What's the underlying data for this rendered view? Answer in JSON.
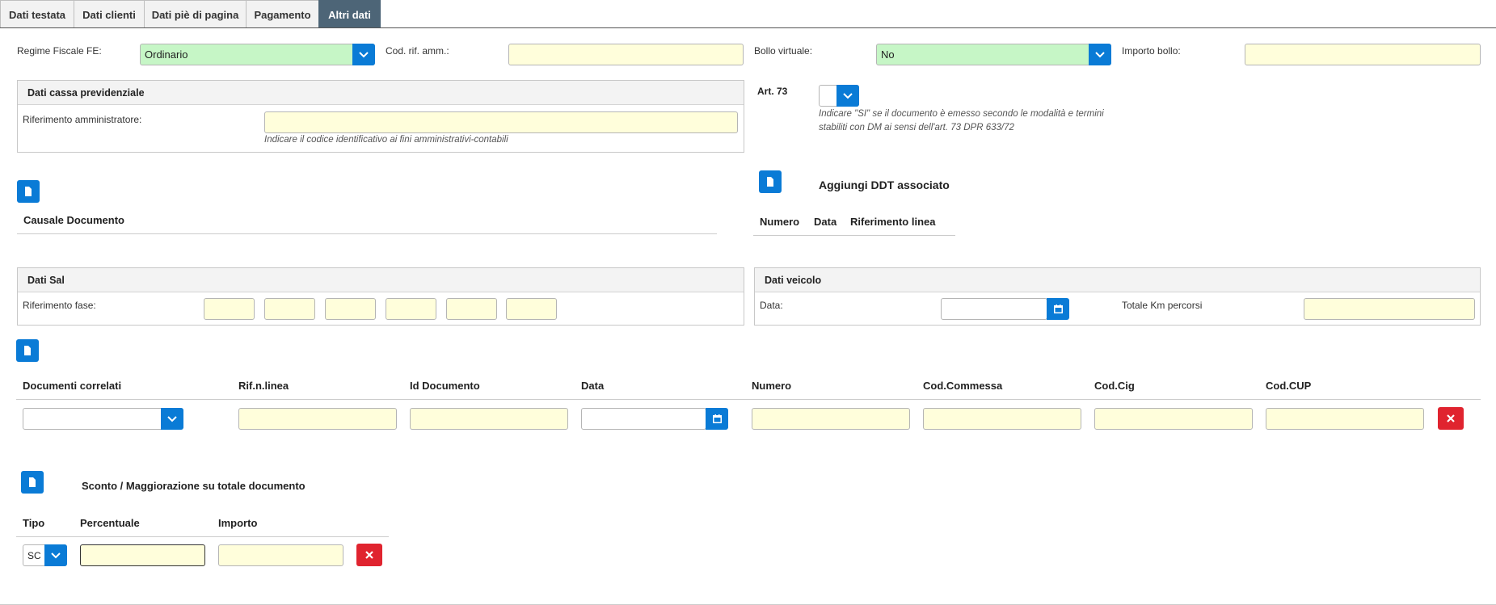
{
  "tabs": [
    "Dati testata",
    "Dati clienti",
    "Dati piè di pagina",
    "Pagamento",
    "Altri dati"
  ],
  "top": {
    "regime_label": "Regime Fiscale FE:",
    "regime_value": "Ordinario",
    "cod_rif_label": "Cod. rif. amm.:",
    "bollo_label": "Bollo virtuale:",
    "bollo_value": "No",
    "importo_bollo_label": "Importo bollo:"
  },
  "cassa": {
    "title": "Dati cassa previdenziale",
    "rif_label": "Riferimento amministratore:",
    "hint": "Indicare il codice identificativo ai fini amministrativi-contabili"
  },
  "art73": {
    "label": "Art. 73",
    "hint_line1": "Indicare \"SI\" se il documento è emesso secondo le modalità e termini",
    "hint_line2": "stabiliti con DM ai sensi dell'art. 73 DPR 633/72"
  },
  "causale": {
    "title": "Causale Documento"
  },
  "ddt": {
    "title": "Aggiungi DDT associato",
    "columns": [
      "Numero",
      "Data",
      "Riferimento linea"
    ]
  },
  "sal": {
    "title": "Dati Sal",
    "rif_label": "Riferimento fase:"
  },
  "veicolo": {
    "title": "Dati veicolo",
    "data_label": "Data:",
    "km_label": "Totale Km percorsi"
  },
  "correlati": {
    "columns": [
      "Documenti correlati",
      "Rif.n.linea",
      "Id Documento",
      "Data",
      "Numero",
      "Cod.Commessa",
      "Cod.Cig",
      "Cod.CUP"
    ]
  },
  "sconto": {
    "title": "Sconto / Maggiorazione su totale documento",
    "columns": [
      "Tipo",
      "Percentuale",
      "Importo"
    ],
    "tipo_value": "SC"
  },
  "colors": {
    "accent": "#0a7bd6",
    "danger": "#e0242f",
    "active_tab": "#4d6577",
    "input_bg": "#fffedb",
    "select_bg": "#c6f6c6"
  }
}
